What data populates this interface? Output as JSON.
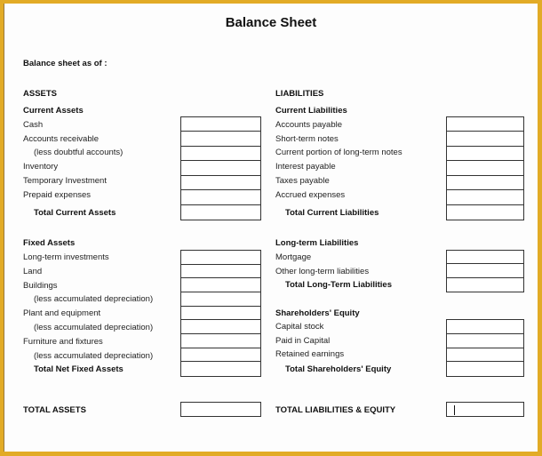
{
  "title": "Balance Sheet",
  "as_of_label": "Balance sheet as of :",
  "assets": {
    "heading": "ASSETS",
    "current": {
      "heading": "Current Assets",
      "items": [
        {
          "label": "Cash",
          "indent": false
        },
        {
          "label": "Accounts receivable",
          "indent": false
        },
        {
          "label": "(less doubtful accounts)",
          "indent": true
        },
        {
          "label": "Inventory",
          "indent": false
        },
        {
          "label": "Temporary Investment",
          "indent": false
        },
        {
          "label": "Prepaid expenses",
          "indent": false
        }
      ],
      "total": "Total Current  Assets"
    },
    "fixed": {
      "heading": "Fixed Assets",
      "items": [
        {
          "label": "Long-term investments",
          "indent": false
        },
        {
          "label": "Land",
          "indent": false
        },
        {
          "label": "Buildings",
          "indent": false
        },
        {
          "label": "(less accumulated depreciation)",
          "indent": true
        },
        {
          "label": "Plant and equipment",
          "indent": false
        },
        {
          "label": "(less accumulated depreciation)",
          "indent": true
        },
        {
          "label": "Furniture and fixtures",
          "indent": false
        },
        {
          "label": "(less accumulated depreciation)",
          "indent": true
        }
      ],
      "total": "Total Net Fixed Assets"
    },
    "grand_total": "TOTAL ASSETS"
  },
  "liabilities": {
    "heading": "LIABILITIES",
    "current": {
      "heading": "Current Liabilities",
      "items": [
        {
          "label": "Accounts payable"
        },
        {
          "label": "Short-term notes"
        },
        {
          "label": "Current portion  of long-term notes"
        },
        {
          "label": "Interest payable"
        },
        {
          "label": "Taxes payable"
        },
        {
          "label": "Accrued expenses"
        }
      ],
      "total": "Total Current  Liabilities"
    },
    "long_term": {
      "heading": "Long-term Liabilities",
      "items": [
        {
          "label": "Mortgage"
        },
        {
          "label": "Other long-term liabilities"
        }
      ],
      "total": "Total Long-Term Liabilities"
    },
    "equity": {
      "heading": "Shareholders' Equity",
      "items": [
        {
          "label": "Capital stock"
        },
        {
          "label": "Paid in Capital"
        },
        {
          "label": "Retained earnings"
        }
      ],
      "total": "Total Shareholders' Equity"
    },
    "grand_total": "TOTAL LIABILITIES & EQUITY"
  },
  "values": {
    "total_assets": "",
    "total_liabilities_equity": ""
  }
}
